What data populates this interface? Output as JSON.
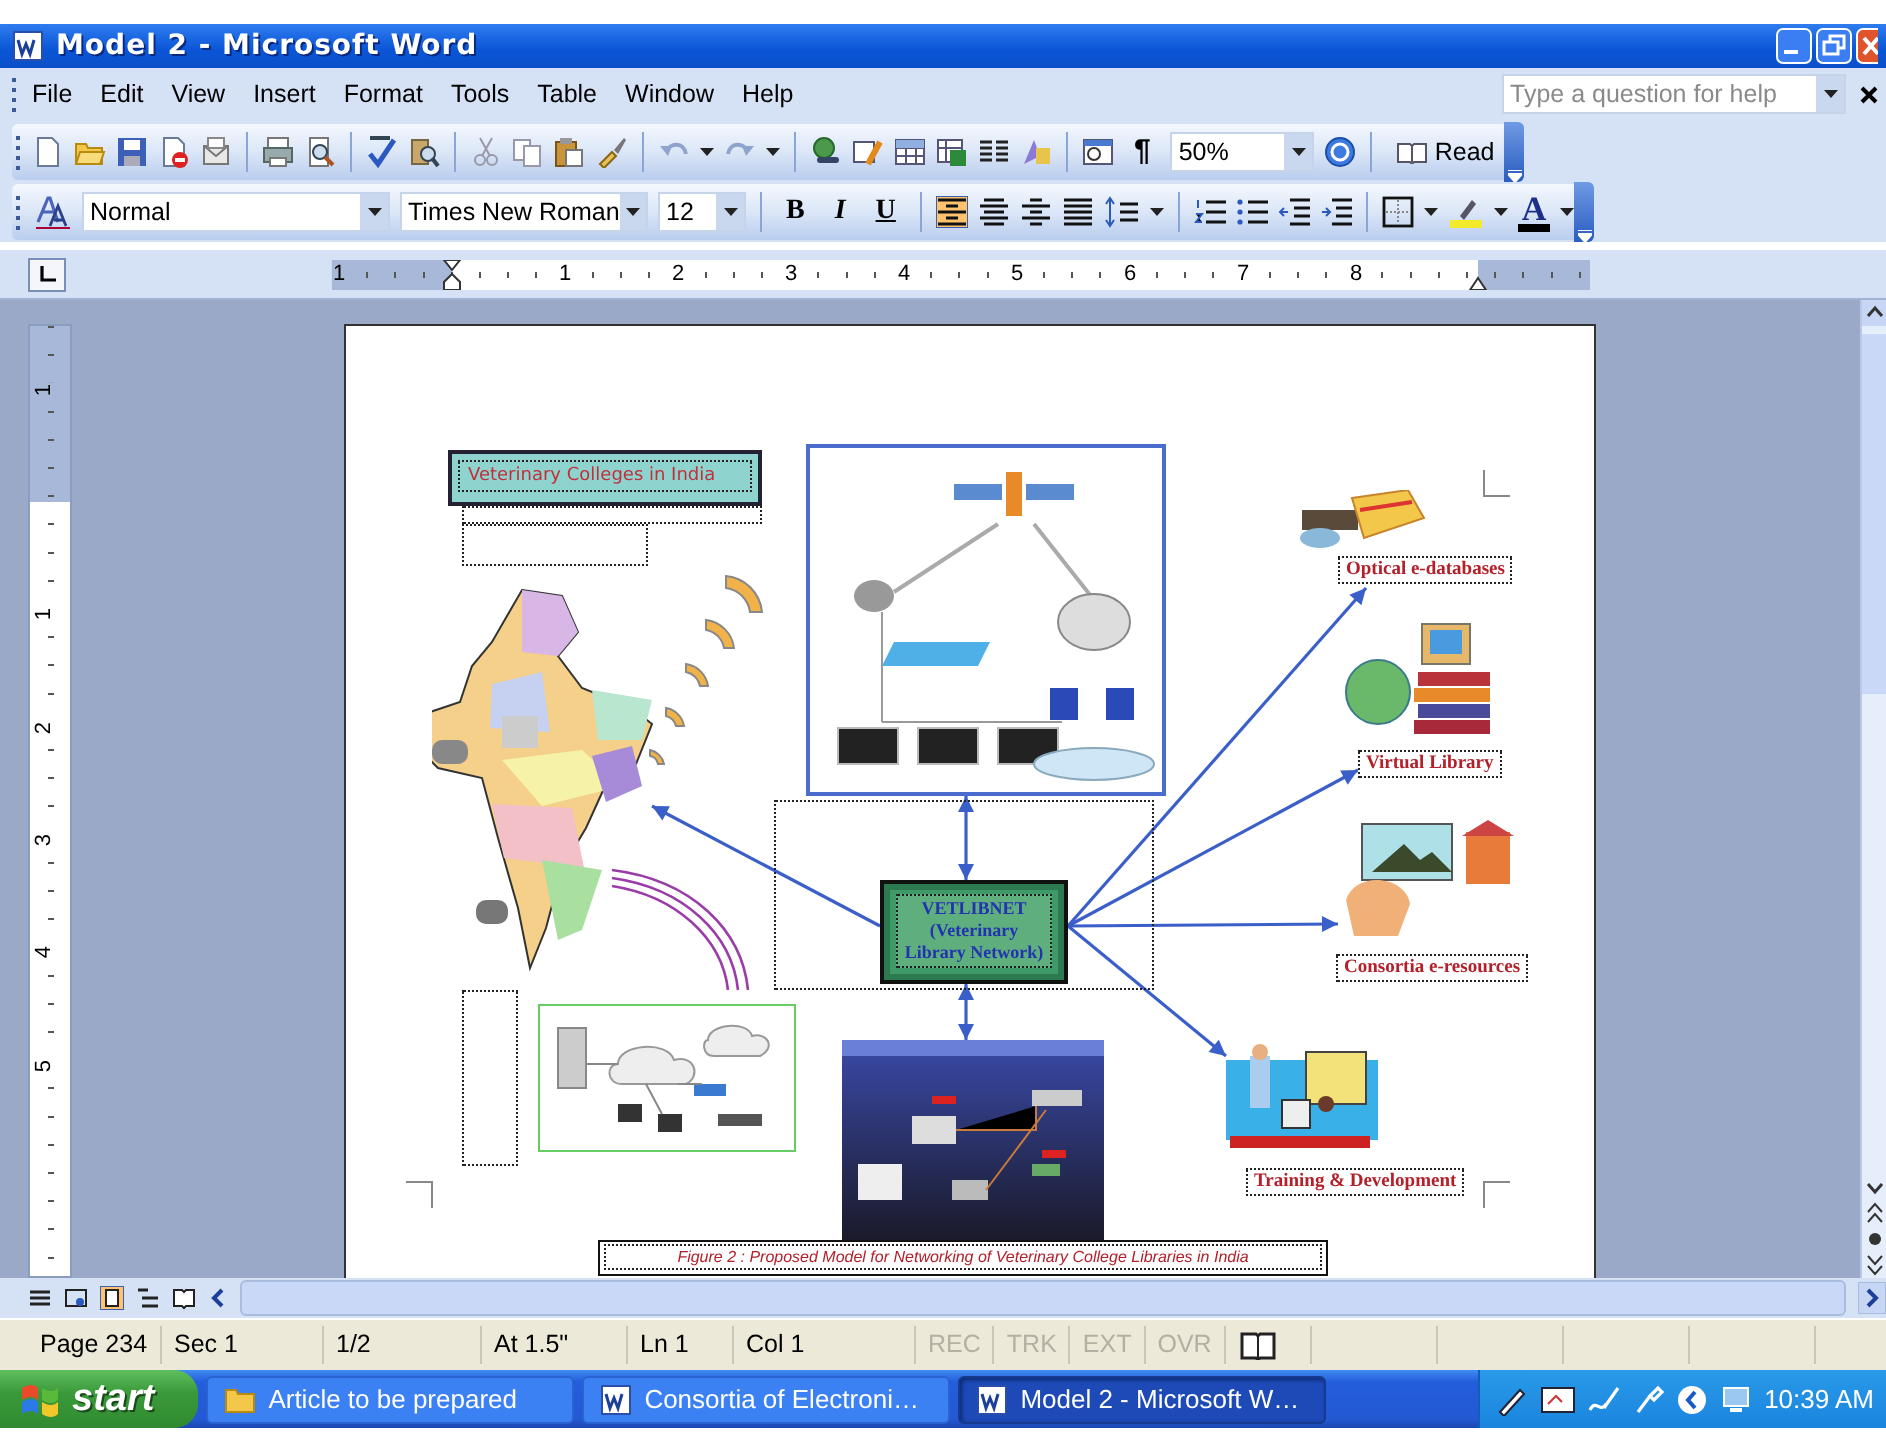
{
  "window": {
    "title": "Model 2 - Microsoft Word"
  },
  "menu": [
    {
      "label": "File"
    },
    {
      "label": "Edit"
    },
    {
      "label": "View"
    },
    {
      "label": "Insert"
    },
    {
      "label": "Format"
    },
    {
      "label": "Tools"
    },
    {
      "label": "Table"
    },
    {
      "label": "Window"
    },
    {
      "label": "Help"
    }
  ],
  "help_box": {
    "placeholder": "Type a question for help"
  },
  "standard_toolbar": {
    "show_marks": "¶",
    "zoom": "50%",
    "read_button": "Read"
  },
  "formatting_toolbar": {
    "style": "Normal",
    "font": "Times New Roman",
    "size": "12",
    "bold": "B",
    "italic": "I",
    "underline": "U",
    "font_color": "A",
    "alignment": [
      {
        "kind": "left",
        "selected": true
      },
      {
        "kind": "center",
        "selected": false
      },
      {
        "kind": "right",
        "selected": false
      },
      {
        "kind": "justify",
        "selected": false
      }
    ]
  },
  "ruler": {
    "horizontal_labels": [
      "1",
      "1",
      "2",
      "3",
      "4",
      "5",
      "6",
      "7",
      "8"
    ],
    "vertical_labels": [
      "1",
      "1",
      "2",
      "3",
      "4",
      "5"
    ]
  },
  "document": {
    "diagram": {
      "title_box": "Veterinary Colleges in India",
      "hub": "VETLIBNET (Veterinary Library Network)",
      "caption": "Figure 2 : Proposed Model for Networking of Veterinary College Libraries in India",
      "outputs": [
        {
          "kind": "databases",
          "label": "Optical e-databases"
        },
        {
          "kind": "library",
          "label": "Virtual Library"
        },
        {
          "kind": "resources",
          "label": "Consortia e-resources"
        },
        {
          "kind": "training",
          "label": "Training & Development"
        }
      ]
    }
  },
  "status_bar": {
    "page": "Page 234",
    "section": "Sec 1",
    "pages": "1/2",
    "at": "At 1.5\"",
    "line": "Ln 1",
    "column": "Col 1",
    "modes": [
      {
        "label": "REC",
        "disabled": true
      },
      {
        "label": "TRK",
        "disabled": true
      },
      {
        "label": "EXT",
        "disabled": true
      },
      {
        "label": "OVR",
        "disabled": true
      }
    ]
  },
  "taskbar": {
    "start": "start",
    "tasks": [
      {
        "kind": "folder",
        "label": "Article to be prepared",
        "selected": false
      },
      {
        "kind": "document",
        "label": "Consortia of Electroni…",
        "selected": false
      },
      {
        "kind": "document",
        "label": "Model 2 - Microsoft W…",
        "selected": true
      }
    ],
    "clock": "10:39 AM"
  }
}
